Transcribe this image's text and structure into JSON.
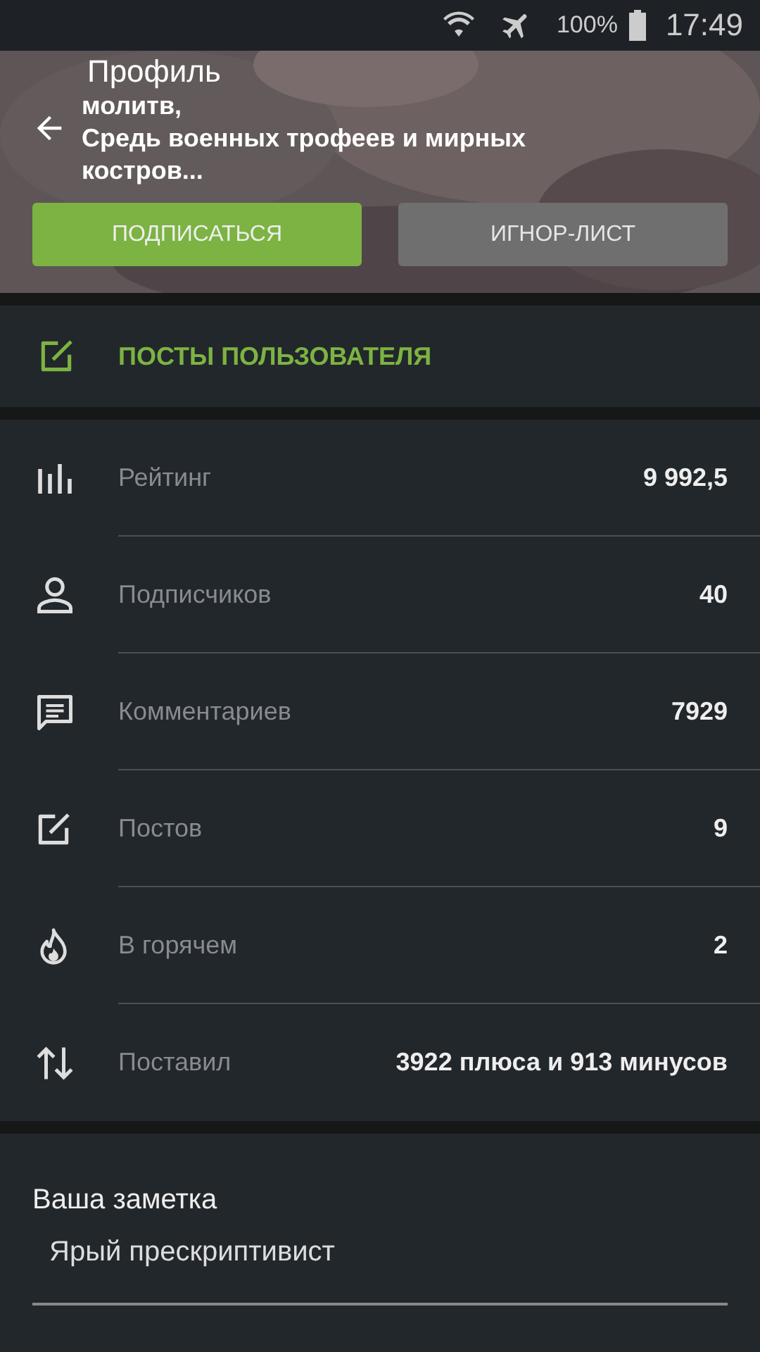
{
  "status_bar": {
    "battery": "100%",
    "time": "17:49"
  },
  "header": {
    "title": "Профиль",
    "quote": "молитв,\nСредь военных трофеев и мирных\nкостров...",
    "buttons": [
      {
        "label": "ПОДПИСАТЬСЯ",
        "kind": "primary"
      },
      {
        "label": "ИГНОР-ЛИСТ",
        "kind": "secondary"
      }
    ]
  },
  "posts_link": {
    "label": "ПОСТЫ ПОЛЬЗОВАТЕЛЯ"
  },
  "stats": [
    {
      "kind": "rating",
      "label": "Рейтинг",
      "value": "9 992,5"
    },
    {
      "kind": "subscribers",
      "label": "Подписчиков",
      "value": "40"
    },
    {
      "kind": "comments",
      "label": "Комментариев",
      "value": "7929"
    },
    {
      "kind": "posts",
      "label": "Постов",
      "value": "9"
    },
    {
      "kind": "hot",
      "label": "В горячем",
      "value": "2"
    },
    {
      "kind": "votes",
      "label": "Поставил",
      "value": "3922 плюса и 913 минусов"
    }
  ],
  "note": {
    "label": "Ваша заметка",
    "value": "Ярый прескриптивист"
  }
}
